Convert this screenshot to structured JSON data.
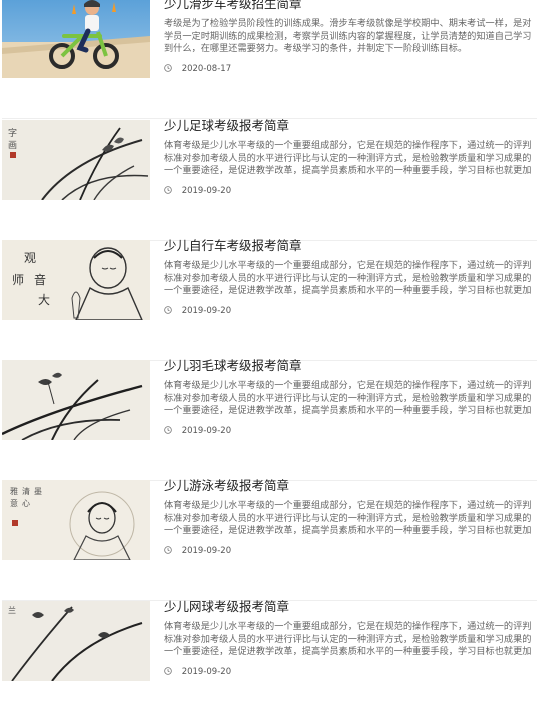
{
  "articles": [
    {
      "title": "少儿滑步车考级招生简章",
      "excerpt": "考级是为了检验学员阶段性的训练成果。滑步车考级就像是学校期中、期末考试一样，是对学员一定时期训练的成果检测，考察学员训练内容的掌握程度，让学员清楚的知道自己学习到什么，在哪里还需要努力。考级学习的条件，并制定下一阶段训练目标。",
      "date": "2020-08-17",
      "thumb_icon": "balance-bike-photo"
    },
    {
      "title": "少儿足球考级报考简章",
      "excerpt": "体育考级是少儿水平考级的一个重要组成部分，它是在规范的操作程序下，通过统一的评判标准对参加考级人员的水平进行评比与认定的一种测评方式，是检验教学质量和学习成果的一个重要途径，是促进教学改革，提高学员素质和水平的一种重要手段，学习目标也就更加明确。",
      "date": "2019-09-20",
      "thumb_icon": "orchid-ink-painting"
    },
    {
      "title": "少儿自行车考级报考简章",
      "excerpt": "体育考级是少儿水平考级的一个重要组成部分，它是在规范的操作程序下，通过统一的评判标准对参加考级人员的水平进行评比与认定的一种测评方式，是检验教学质量和学习成果的一个重要途径，是促进教学改革，提高学员素质和水平的一种重要手段，学习目标也就更加明确。",
      "date": "2019-09-20",
      "thumb_icon": "guanyin-ink-painting"
    },
    {
      "title": "少儿羽毛球考级报考简章",
      "excerpt": "体育考级是少儿水平考级的一个重要组成部分，它是在规范的操作程序下，通过统一的评判标准对参加考级人员的水平进行评比与认定的一种测评方式，是检验教学质量和学习成果的一个重要途径，是促进教学改革，提高学员素质和水平的一种重要手段，学习目标也就更加明确。",
      "date": "2019-09-20",
      "thumb_icon": "orchid-ink-painting"
    },
    {
      "title": "少儿游泳考级报考简章",
      "excerpt": "体育考级是少儿水平考级的一个重要组成部分，它是在规范的操作程序下，通过统一的评判标准对参加考级人员的水平进行评比与认定的一种测评方式，是检验教学质量和学习成果的一个重要途径，是促进教学改革，提高学员素质和水平的一种重要手段，学习目标也就更加明确。",
      "date": "2019-09-20",
      "thumb_icon": "guanyin-ink-painting"
    },
    {
      "title": "少儿网球考级报考简章",
      "excerpt": "体育考级是少儿水平考级的一个重要组成部分，它是在规范的操作程序下，通过统一的评判标准对参加考级人员的水平进行评比与认定的一种测评方式，是检验教学质量和学习成果的一个重要途径，是促进教学改革，提高学员素质和水平的一种重要手段，学习目标也就更加明确。",
      "date": "2019-09-20",
      "thumb_icon": "orchid-ink-painting"
    }
  ],
  "colors": {
    "title": "#222222",
    "excerpt": "#666666",
    "meta": "#555555",
    "divider": "#eeeeee",
    "paper": "#f1efe9"
  }
}
